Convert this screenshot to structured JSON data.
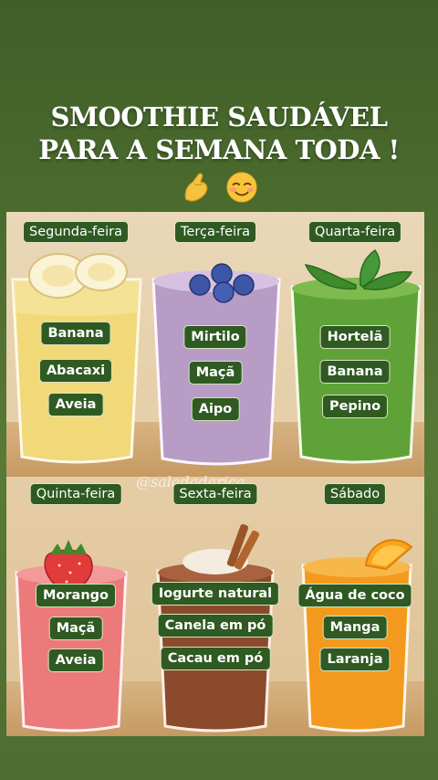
{
  "title": {
    "line1": "SMOOTHIE SAUDÁVEL",
    "line2": "PARA A SEMANA TODA !"
  },
  "emojis": [
    "pinched-fingers-icon",
    "smiling-face-icon"
  ],
  "watermark": "@saladadarica",
  "days": [
    {
      "name": "Segunda-feira",
      "ingredients": [
        "Banana",
        "Abacaxi",
        "Aveia"
      ],
      "color": "#f1d97a",
      "garnish": "banana-slices-icon"
    },
    {
      "name": "Terça-feira",
      "ingredients": [
        "Mirtilo",
        "Maçã",
        "Aipo"
      ],
      "color": "#b79cc6",
      "garnish": "blueberries-icon"
    },
    {
      "name": "Quarta-feira",
      "ingredients": [
        "Hortelã",
        "Banana",
        "Pepino"
      ],
      "color": "#5fa238",
      "garnish": "mint-leaves-icon"
    },
    {
      "name": "Quinta-feira",
      "ingredients": [
        "Morango",
        "Maçã",
        "Aveia"
      ],
      "color": "#ec7a7a",
      "garnish": "strawberry-icon"
    },
    {
      "name": "Sexta-feira",
      "ingredients": [
        "Iogurte natural",
        "Canela em pó",
        "Cacau em pó"
      ],
      "color": "#8b4a2c",
      "garnish": "cinnamon-sticks-icon"
    },
    {
      "name": "Sábado",
      "ingredients": [
        "Água de coco",
        "Manga",
        "Laranja"
      ],
      "color": "#f39a1e",
      "garnish": "orange-slice-icon"
    }
  ]
}
